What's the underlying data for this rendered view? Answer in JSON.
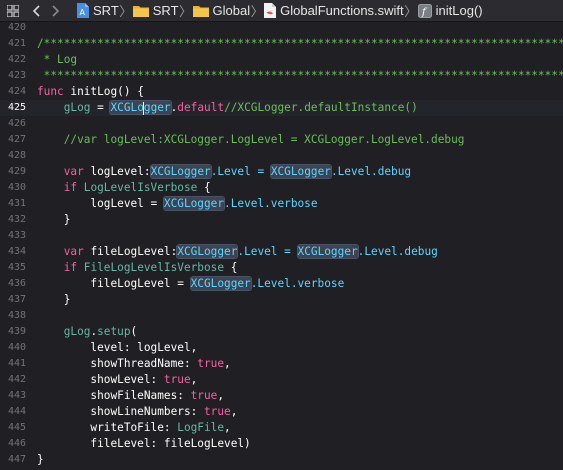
{
  "jumpbar": {
    "crumbs": [
      {
        "label": "SRT"
      },
      {
        "label": "SRT"
      },
      {
        "label": "Global"
      },
      {
        "label": "GlobalFunctions.swift"
      },
      {
        "label": "initLog()"
      }
    ]
  },
  "editor": {
    "current_line": 425,
    "lines": [
      {
        "n": 420,
        "tokens": []
      },
      {
        "n": 421,
        "tokens": [
          {
            "t": "/******************************************************************************",
            "c": "cm"
          }
        ]
      },
      {
        "n": 422,
        "tokens": [
          {
            "t": " * Log",
            "c": "cm"
          }
        ]
      },
      {
        "n": 423,
        "tokens": [
          {
            "t": " ******************************************************************************/",
            "c": "cm"
          }
        ]
      },
      {
        "n": 424,
        "tokens": [
          {
            "t": "func",
            "c": "kw"
          },
          {
            "t": " initLog() {",
            "c": "tx"
          }
        ]
      },
      {
        "n": 425,
        "tokens": [
          {
            "t": "    ",
            "c": "tx"
          },
          {
            "t": "gLog",
            "c": "pr"
          },
          {
            "t": " = ",
            "c": "tx"
          },
          {
            "t": "XCGLo",
            "c": "ty",
            "hl": "start"
          },
          {
            "t": "caret"
          },
          {
            "t": "gger",
            "c": "ty",
            "hl": "end"
          },
          {
            "t": ".",
            "c": "tx"
          },
          {
            "t": "default",
            "c": "kw"
          },
          {
            "t": "//XCGLogger.defaultInstance()",
            "c": "cm"
          }
        ]
      },
      {
        "n": 426,
        "tokens": []
      },
      {
        "n": 427,
        "tokens": [
          {
            "t": "    //var logLevel:XCGLogger.LogLevel = XCGLogger.LogLevel.debug",
            "c": "cm"
          }
        ]
      },
      {
        "n": 428,
        "tokens": []
      },
      {
        "n": 429,
        "tokens": [
          {
            "t": "    ",
            "c": "tx"
          },
          {
            "t": "var",
            "c": "kw"
          },
          {
            "t": " logLevel:",
            "c": "tx"
          },
          {
            "t": "XCGLogger",
            "c": "ty",
            "hl": "full"
          },
          {
            "t": ".Level = ",
            "c": "ty"
          },
          {
            "t": "XCGLogger",
            "c": "ty",
            "hl": "full"
          },
          {
            "t": ".Level.debug",
            "c": "ty"
          }
        ]
      },
      {
        "n": 430,
        "tokens": [
          {
            "t": "    ",
            "c": "tx"
          },
          {
            "t": "if",
            "c": "kw"
          },
          {
            "t": " ",
            "c": "tx"
          },
          {
            "t": "LogLevelIsVerbose",
            "c": "pr"
          },
          {
            "t": " {",
            "c": "tx"
          }
        ]
      },
      {
        "n": 431,
        "tokens": [
          {
            "t": "        logLevel = ",
            "c": "tx"
          },
          {
            "t": "XCGLogger",
            "c": "ty",
            "hl": "full"
          },
          {
            "t": ".Level.verbose",
            "c": "ty"
          }
        ]
      },
      {
        "n": 432,
        "tokens": [
          {
            "t": "    }",
            "c": "tx"
          }
        ]
      },
      {
        "n": 433,
        "tokens": []
      },
      {
        "n": 434,
        "tokens": [
          {
            "t": "    ",
            "c": "tx"
          },
          {
            "t": "var",
            "c": "kw"
          },
          {
            "t": " fileLogLevel:",
            "c": "tx"
          },
          {
            "t": "XCGLogger",
            "c": "ty",
            "hl": "full"
          },
          {
            "t": ".Level = ",
            "c": "ty"
          },
          {
            "t": "XCGLogger",
            "c": "ty",
            "hl": "full"
          },
          {
            "t": ".Level.debug",
            "c": "ty"
          }
        ]
      },
      {
        "n": 435,
        "tokens": [
          {
            "t": "    ",
            "c": "tx"
          },
          {
            "t": "if",
            "c": "kw"
          },
          {
            "t": " ",
            "c": "tx"
          },
          {
            "t": "FileLogLevelIsVerbose",
            "c": "pr"
          },
          {
            "t": " {",
            "c": "tx"
          }
        ]
      },
      {
        "n": 436,
        "tokens": [
          {
            "t": "        fileLogLevel = ",
            "c": "tx"
          },
          {
            "t": "XCGLogger",
            "c": "ty",
            "hl": "full"
          },
          {
            "t": ".Level.verbose",
            "c": "ty"
          }
        ]
      },
      {
        "n": 437,
        "tokens": [
          {
            "t": "    }",
            "c": "tx"
          }
        ]
      },
      {
        "n": 438,
        "tokens": []
      },
      {
        "n": 439,
        "tokens": [
          {
            "t": "    ",
            "c": "tx"
          },
          {
            "t": "gLog",
            "c": "pr"
          },
          {
            "t": ".",
            "c": "tx"
          },
          {
            "t": "setup",
            "c": "pr"
          },
          {
            "t": "(",
            "c": "tx"
          }
        ]
      },
      {
        "n": 440,
        "tokens": [
          {
            "t": "        level: logLevel,",
            "c": "tx"
          }
        ]
      },
      {
        "n": 441,
        "tokens": [
          {
            "t": "        showThreadName: ",
            "c": "tx"
          },
          {
            "t": "true",
            "c": "kw"
          },
          {
            "t": ",",
            "c": "tx"
          }
        ]
      },
      {
        "n": 442,
        "tokens": [
          {
            "t": "        showLevel: ",
            "c": "tx"
          },
          {
            "t": "true",
            "c": "kw"
          },
          {
            "t": ",",
            "c": "tx"
          }
        ]
      },
      {
        "n": 443,
        "tokens": [
          {
            "t": "        showFileNames: ",
            "c": "tx"
          },
          {
            "t": "true",
            "c": "kw"
          },
          {
            "t": ",",
            "c": "tx"
          }
        ]
      },
      {
        "n": 444,
        "tokens": [
          {
            "t": "        showLineNumbers: ",
            "c": "tx"
          },
          {
            "t": "true",
            "c": "kw"
          },
          {
            "t": ",",
            "c": "tx"
          }
        ]
      },
      {
        "n": 445,
        "tokens": [
          {
            "t": "        writeToFile: ",
            "c": "tx"
          },
          {
            "t": "LogFile",
            "c": "pr"
          },
          {
            "t": ",",
            "c": "tx"
          }
        ]
      },
      {
        "n": 446,
        "tokens": [
          {
            "t": "        fileLevel: fileLogLevel)",
            "c": "tx"
          }
        ]
      },
      {
        "n": 447,
        "tokens": [
          {
            "t": "}",
            "c": "tx"
          }
        ]
      }
    ]
  },
  "colors": {
    "editor_bg": "#1f1f24",
    "keyword": "#fc5fa3",
    "comment": "#6bbf59",
    "type": "#5dd8ff",
    "project_symbol": "#67b7a4",
    "plain": "#ffffff"
  },
  "icons": [
    "grid-icon",
    "back-arrow-icon",
    "forward-arrow-icon",
    "swift-project-icon",
    "folder-icon",
    "swift-file-icon",
    "function-symbol-icon"
  ]
}
